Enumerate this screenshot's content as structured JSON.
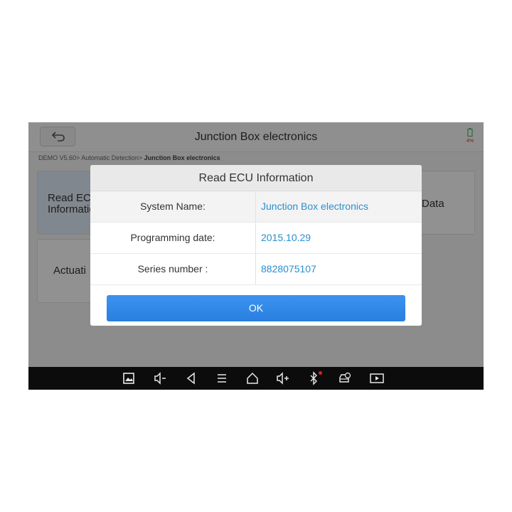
{
  "app": {
    "title": "Junction Box electronics",
    "battery_percent": "4%",
    "breadcrumb_prefix": "DEMO V5.60> Automatic Detection> ",
    "breadcrumb_current": "Junction Box electronics"
  },
  "tiles": {
    "read_ecu": "Read ECU Information",
    "data": "Data",
    "actuation": "Actuati"
  },
  "dialog": {
    "title": "Read ECU Information",
    "rows": [
      {
        "label": "System Name:",
        "value": "Junction Box electronics"
      },
      {
        "label": "Programming date:",
        "value": "2015.10.29"
      },
      {
        "label": "Series number :",
        "value": "8828075107"
      }
    ],
    "ok_label": "OK"
  },
  "navbar": {
    "icons": [
      "screenshot-icon",
      "volume-down-icon",
      "back-nav-icon",
      "menu-icon",
      "home-icon",
      "volume-up-icon",
      "bluetooth-icon",
      "vci-icon",
      "screen-record-icon"
    ]
  },
  "colors": {
    "accent": "#2a8fd0",
    "button": "#2f86e6",
    "navbar": "#0c0c0c"
  }
}
